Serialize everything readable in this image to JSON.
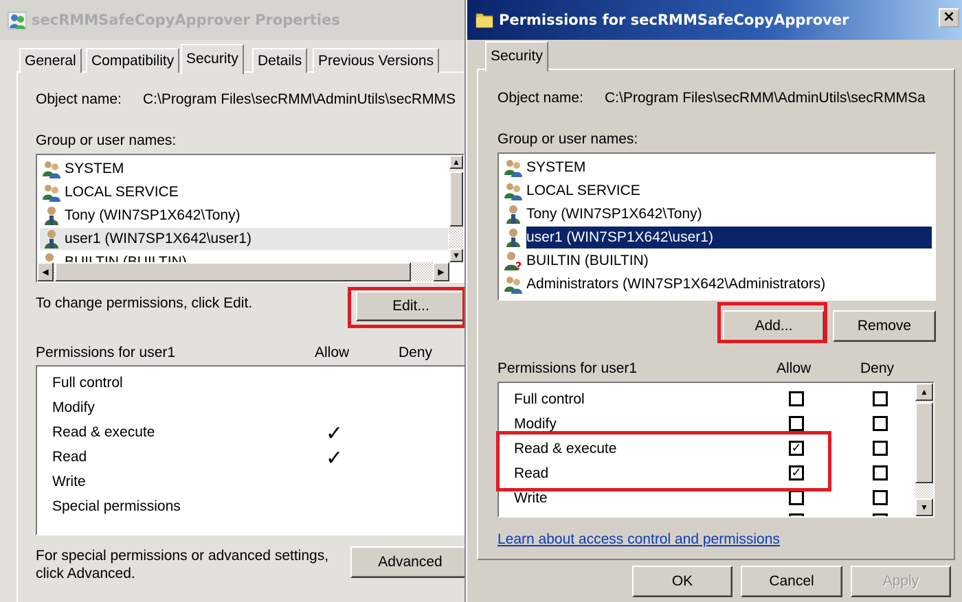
{
  "properties_window": {
    "title": "secRMMSafeCopyApprover Properties",
    "tabs": [
      "General",
      "Compatibility",
      "Security",
      "Details",
      "Previous Versions"
    ],
    "active_tab": "Security",
    "object_name_label": "Object name:",
    "object_name_value": "C:\\Program Files\\secRMM\\AdminUtils\\secRMMS",
    "group_label": "Group or user names:",
    "users": [
      {
        "name": "SYSTEM",
        "icon": "group-users-icon"
      },
      {
        "name": "LOCAL SERVICE",
        "icon": "group-users-icon"
      },
      {
        "name": "Tony (WIN7SP1X642\\Tony)",
        "icon": "user-icon"
      },
      {
        "name": "user1 (WIN7SP1X642\\user1)",
        "icon": "user-icon",
        "state": "focused"
      },
      {
        "name": "BUILTIN (BUILTIN)",
        "icon": "unknown-user-icon"
      }
    ],
    "change_hint": "To change permissions, click Edit.",
    "edit_label": "Edit...",
    "perm_header": "Permissions for user1",
    "allow_header": "Allow",
    "deny_header": "Deny",
    "permissions": [
      {
        "name": "Full control",
        "allow": false
      },
      {
        "name": "Modify",
        "allow": false
      },
      {
        "name": "Read & execute",
        "allow": true
      },
      {
        "name": "Read",
        "allow": true
      },
      {
        "name": "Write",
        "allow": false
      },
      {
        "name": "Special permissions",
        "allow": false
      }
    ],
    "check_glyph": "✓",
    "advanced_hint_line1": "For special permissions or advanced settings,",
    "advanced_hint_line2": "click Advanced.",
    "advanced_label": "Advanced"
  },
  "permissions_window": {
    "title": "Permissions for secRMMSafeCopyApprover",
    "close_glyph": "×",
    "tab": "Security",
    "object_name_label": "Object name:",
    "object_name_value": "C:\\Program Files\\secRMM\\AdminUtils\\secRMMSa",
    "group_label": "Group or user names:",
    "users": [
      {
        "name": "SYSTEM",
        "icon": "group-users-icon"
      },
      {
        "name": "LOCAL SERVICE",
        "icon": "group-users-icon"
      },
      {
        "name": "Tony (WIN7SP1X642\\Tony)",
        "icon": "user-icon"
      },
      {
        "name": "user1 (WIN7SP1X642\\user1)",
        "icon": "user-icon",
        "state": "selected"
      },
      {
        "name": "BUILTIN (BUILTIN)",
        "icon": "unknown-user-icon"
      },
      {
        "name": "Administrators (WIN7SP1X642\\Administrators)",
        "icon": "group-users-icon"
      }
    ],
    "add_label": "Add...",
    "remove_label": "Remove",
    "perm_header": "Permissions for user1",
    "allow_header": "Allow",
    "deny_header": "Deny",
    "permissions": [
      {
        "name": "Full control",
        "allow": false,
        "deny": false
      },
      {
        "name": "Modify",
        "allow": false,
        "deny": false
      },
      {
        "name": "Read & execute",
        "allow": true,
        "deny": false
      },
      {
        "name": "Read",
        "allow": true,
        "deny": false
      },
      {
        "name": "Write",
        "allow": false,
        "deny": false
      }
    ],
    "box_checked_glyph": "✓",
    "learn_link": "Learn about access control and permissions",
    "ok_label": "OK",
    "cancel_label": "Cancel",
    "apply_label": "Apply"
  },
  "colors": {
    "highlight_border": "#e01b24",
    "selection": "#0a246a",
    "link": "#0b3db5"
  }
}
